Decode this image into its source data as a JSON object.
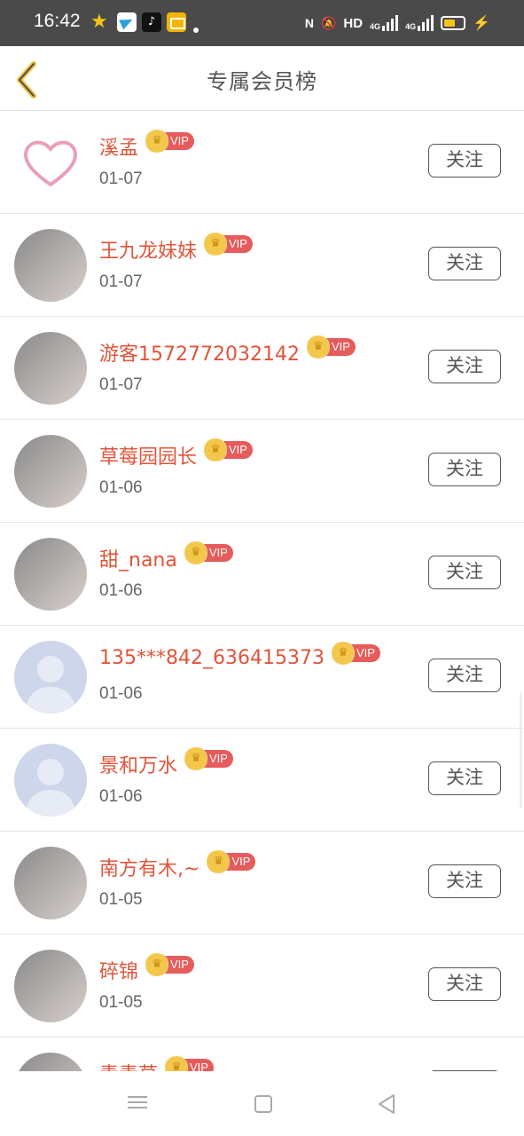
{
  "status_bar": {
    "time": "16:42",
    "icons": [
      "star-icon",
      "telegram-icon",
      "tiktok-icon",
      "mail-icon"
    ],
    "right_text": "HD",
    "network1": "4G",
    "network2": "4G"
  },
  "header": {
    "title": "专属会员榜",
    "back_icon": "chevron-left-icon",
    "accent_color": "#f0c040"
  },
  "vip_label": "VIP",
  "follow_label": "关注",
  "members": [
    {
      "name": "溪孟",
      "date": "01-07",
      "avatar": "heart"
    },
    {
      "name": "王九龙妹妹",
      "date": "01-07",
      "avatar": "photo"
    },
    {
      "name": "游客1572772032142",
      "date": "01-07",
      "avatar": "photo"
    },
    {
      "name": "草莓园园长",
      "date": "01-06",
      "avatar": "photo"
    },
    {
      "name": "甜_nana",
      "date": "01-06",
      "avatar": "photo"
    },
    {
      "name": "135***842_636415373",
      "date": "01-06",
      "avatar": "default"
    },
    {
      "name": "景和万水",
      "date": "01-06",
      "avatar": "default"
    },
    {
      "name": "南方有木,~",
      "date": "01-05",
      "avatar": "photo"
    },
    {
      "name": "碎锦",
      "date": "01-05",
      "avatar": "photo"
    },
    {
      "name": "青青草",
      "date": "",
      "avatar": "photo"
    }
  ],
  "nav_bar": {
    "icons": [
      "menu-icon",
      "home-icon",
      "back-icon"
    ]
  }
}
